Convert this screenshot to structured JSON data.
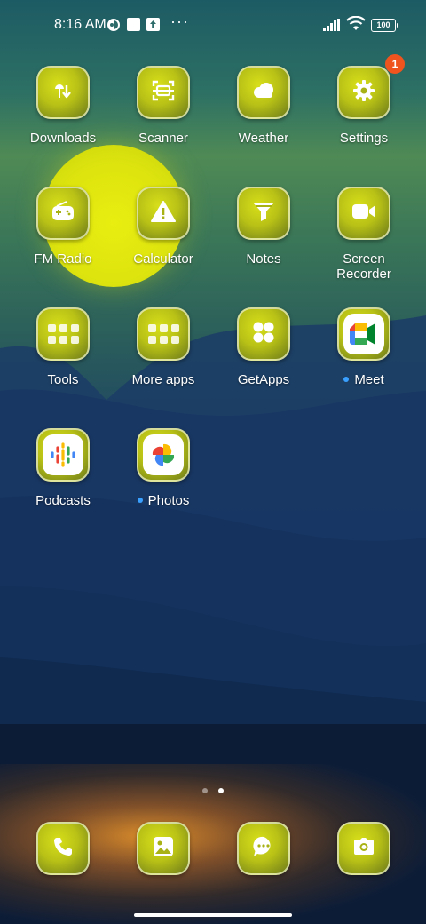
{
  "status_bar": {
    "time": "8:16 AM",
    "more": "···",
    "battery": "100",
    "icons": [
      "carrier-notification-icon",
      "square-notification-icon",
      "upload-notification-icon",
      "signal-icon",
      "wifi-icon",
      "battery-icon"
    ]
  },
  "apps": [
    {
      "label": "Downloads",
      "icon": "download-icon"
    },
    {
      "label": "Scanner",
      "icon": "scanner-icon"
    },
    {
      "label": "Weather",
      "icon": "cloud-icon"
    },
    {
      "label": "Settings",
      "icon": "gear-icon",
      "badge": "1"
    },
    {
      "label": "FM Radio",
      "icon": "radio-icon"
    },
    {
      "label": "Calculator",
      "icon": "calculator-warning-icon"
    },
    {
      "label": "Notes",
      "icon": "notes-icon"
    },
    {
      "label": "Screen\nRecorder",
      "icon": "video-camera-icon"
    },
    {
      "label": "Tools",
      "icon": "folder-icon"
    },
    {
      "label": "More apps",
      "icon": "folder-icon"
    },
    {
      "label": "GetApps",
      "icon": "apps-grid-icon"
    },
    {
      "label": "Meet",
      "icon": "meet-icon",
      "new": true
    },
    {
      "label": "Podcasts",
      "icon": "podcasts-icon"
    },
    {
      "label": "Photos",
      "icon": "photos-icon",
      "new": true
    }
  ],
  "dock": [
    {
      "name": "phone",
      "icon": "phone-icon"
    },
    {
      "name": "gallery",
      "icon": "gallery-icon"
    },
    {
      "name": "messages",
      "icon": "message-icon"
    },
    {
      "name": "camera",
      "icon": "camera-icon"
    }
  ],
  "pager": {
    "pages": 2,
    "active": 2
  },
  "colors": {
    "tile": "#c6ce17",
    "badge": "#f0541e",
    "new_dot": "#3aa0ff",
    "sun": "#e4ea10"
  }
}
